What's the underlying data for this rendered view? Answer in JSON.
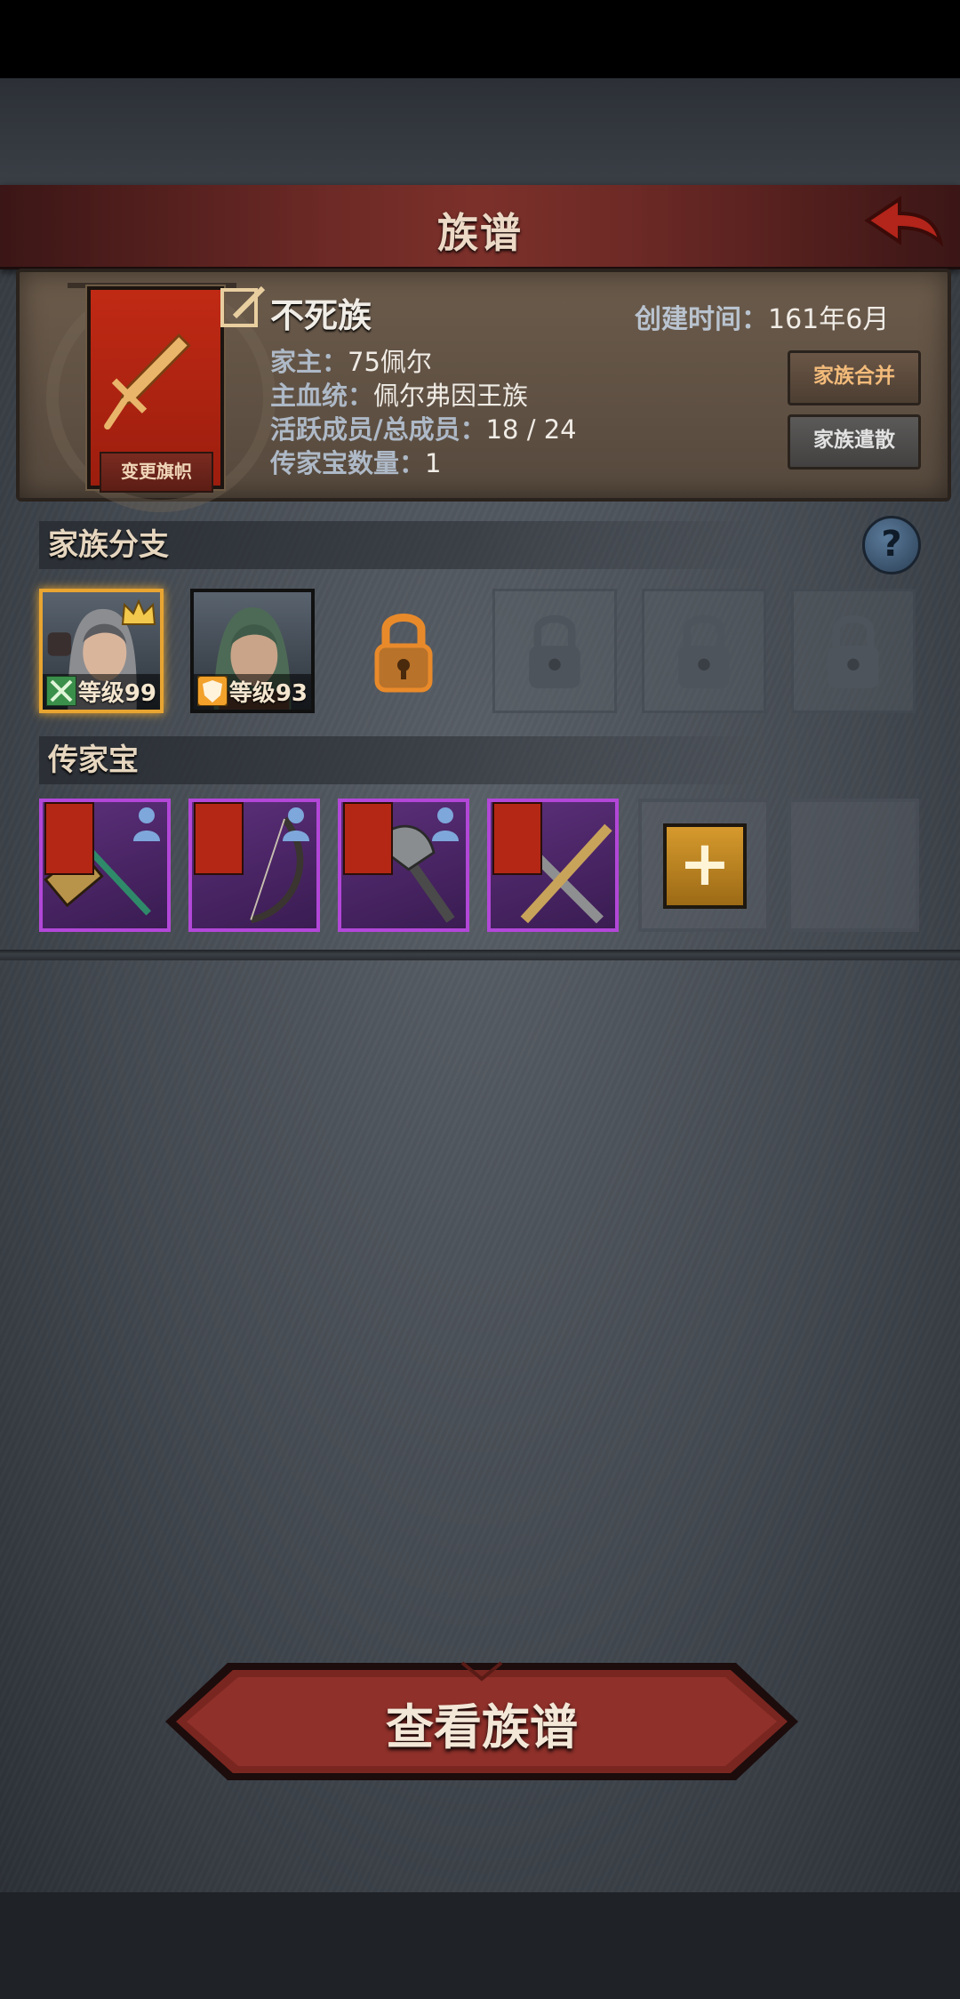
{
  "header": {
    "title": "族谱"
  },
  "family": {
    "name": "不死族",
    "change_banner_label": "变更旗帜",
    "created_label": "创建时间：",
    "created_value": "161年6月",
    "head_label": "家主：",
    "head_value": "75佩尔",
    "bloodline_label": "主血统：",
    "bloodline_value": "佩尔弗因王族",
    "members_label": "活跃成员/总成员：",
    "members_value": "18 / 24",
    "heirloom_count_label": "传家宝数量：",
    "heirloom_count_value": "1",
    "merge_label": "家族合并",
    "disband_label": "家族遣散"
  },
  "branches": {
    "title": "家族分支",
    "help_label": "?",
    "members": [
      {
        "level_text": "等级99",
        "leader": true
      },
      {
        "level_text": "等级93",
        "leader": false
      }
    ],
    "locked_slots": 4
  },
  "heirlooms": {
    "title": "传家宝",
    "items": [
      "hammer-heirloom",
      "bow-heirloom",
      "axe-heirloom",
      "crossed-swords-heirloom"
    ],
    "add_label": "+"
  },
  "footer": {
    "view_genealogy_label": "查看族谱"
  },
  "colors": {
    "accent_red": "#9c1d0e",
    "gold": "#e8a531",
    "epic_purple": "#b247d8"
  }
}
